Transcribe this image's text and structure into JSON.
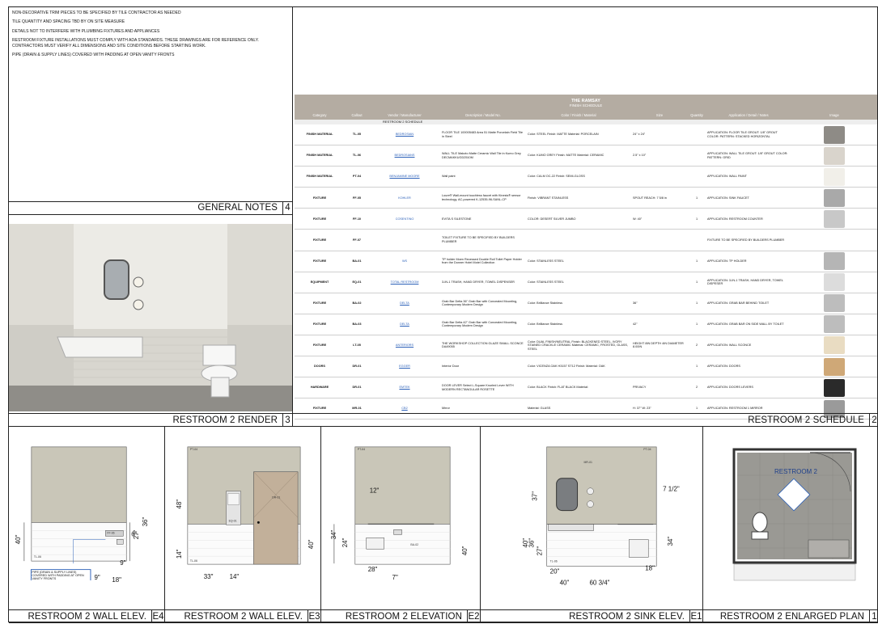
{
  "notes": {
    "lines": [
      "NON-DECORATIVE TRIM PIECES TO BE SPECIFIED BY TILE CONTRACTOR AS NEEDED",
      "TILE QUANTITY AND SPACING TBD BY ON SITE MEASURE",
      "DETAILS NOT TO INTERFERE WITH PLUMBING FIXTURES AND APPLIANCES",
      "RESTROOM FIXTURE INSTALLATIONS MUST COMPLY WITH ADA STANDARDS. THESE DRAWINGS ARE FOR REFERENCE ONLY. CONTRACTORS MUST VERIFY ALL DIMENSIONS AND SITE CONDITIONS BEFORE STARTING WORK.",
      "PIPE (DRAIN & SUPPLY LINES) COVERED WITH PADDING AT OPEN VANITY FRONTS"
    ],
    "title": "GENERAL NOTES",
    "number": "4"
  },
  "render": {
    "title": "RESTROOM 2 RENDER",
    "number": "3"
  },
  "schedule": {
    "title": "RESTROOM 2 SCHEDULE",
    "number": "2",
    "header_title": "THE RAMSAY",
    "header_subtitle": "FINISH SCHEDULE",
    "section": "RESTROOM 2 SCHEDULE",
    "columns": [
      "Category",
      "Callout",
      "Vendor / Manufacturer",
      "Description / Model No.",
      "Color / Finish / Material",
      "Size",
      "Quantity",
      "Application / Detail / Notes",
      "Image"
    ],
    "rows": [
      {
        "cat": "FINISH MATERIAL",
        "call": "TL-05",
        "vend": "BEDROSIAN",
        "desc": "FLOOR TILE 100005483 Area 51 Matte Porcelain Field Tile in Steel",
        "color": "Color: STEEL Finish: MATTE Material: PORCELAIN",
        "size": "24\" x 24\"",
        "qty": "",
        "app": "APPLICATION: FLOOR TILE GROUT: 1/8\" GROUT COLOR: PATTERN: STACKED HORIZONTAL",
        "img": "#8e8b86"
      },
      {
        "cat": "FINISH MATERIAL",
        "call": "TL-06",
        "vend": "BEDROSIANS",
        "desc": "WALL TILE Makoto Matte Ceramic Wall Tile in Kumo Grey DECMAKKUGD2510M",
        "color": "Color: KUMO GREY Finish: MATTE Material: CERAMIC",
        "size": "2.5\" x 10\"",
        "qty": "",
        "app": "APPLICATION: WALL TILE GROUT: 1/8\" GROUT COLOR: PATTERN: GRID",
        "img": "#d9d4cc"
      },
      {
        "cat": "FINISH MATERIAL",
        "call": "PT-04",
        "vend": "BENJAMINE MOORE",
        "desc": "Wall paint",
        "color": "Color: CALM OC-22 Finish: SEMI-GLOSS",
        "size": "",
        "qty": "",
        "app": "APPLICATION: WALL PAINT",
        "img": "#f1efe9"
      },
      {
        "cat": "FIXTURE",
        "call": "FF-05",
        "vend": "KOHLER",
        "desc": "Loure® Wall-mount touchless faucet with Kinesis® sensor technology, AC-powered K-12535-96-SANL-CP",
        "color": "Finish: VIBRANT STAINLESS",
        "size": "SPOUT REACH: 7 5/8 in",
        "qty": "1",
        "app": "APPLICATION: SINK FAUCET",
        "img": "#a9a9a9"
      },
      {
        "cat": "FIXTURE",
        "call": "FF-10",
        "vend": "COSENTINO",
        "desc": "EVITA S SILESTONE",
        "color": "COLOR: DESERT SILVER JUMBO",
        "size": "W: 40\"",
        "qty": "1",
        "app": "APPLICATION: RESTROOM COUNTER",
        "img": "#c8c8c8"
      },
      {
        "cat": "FIXTURE",
        "call": "FF-07",
        "vend": "",
        "desc": "TOILET FIXTURE TO BE SPECIFIED BY BUILDERS PLUMBER",
        "color": "",
        "size": "",
        "qty": "",
        "app": "FIXTURE TO BE SPECIFIED BY BUILDERS PLUMBER",
        "img": ""
      },
      {
        "cat": "FIXTURE",
        "call": "BA-01",
        "vend": "WS",
        "desc": "TP holder Moen Recessed Double Roll Toilet Paper Holder from the Donner Hotel Motel Collection",
        "color": "Color: STAINLESS STEEL",
        "size": "",
        "qty": "1",
        "app": "APPLICATION: TP HOLDER",
        "img": "#b5b5b5"
      },
      {
        "cat": "EQUIPMENT",
        "call": "EQ-01",
        "vend": "TOTAL RESTROOM",
        "desc": "3-IN-1 TRASH, HAND DRYER, TOWEL DISPENSER",
        "color": "Color: STAINLESS STEEL",
        "size": "",
        "qty": "1",
        "app": "APPLICATION: 3-IN-1 TRASH, HAND DRYER, TOWEL DISPESER",
        "img": "#dcdcdc"
      },
      {
        "cat": "FIXTURE",
        "call": "BA-02",
        "vend": "DELTA",
        "desc": "Grab Bar Delta 36\" Grab Bar with Concealed Mounting, Contemporary Modern Design",
        "color": "Color: Brilliance Stainless",
        "size": "36\"",
        "qty": "1",
        "app": "APPLICATION: GRAB BAR BEHIND TOILET",
        "img": "#bdbdbd"
      },
      {
        "cat": "FIXTURE",
        "call": "BA-03",
        "vend": "DELTA",
        "desc": "Grab Bar Delta 42\" Grab Bar with Concealed Mounting, Contemporary Modern Design",
        "color": "Color: Brilliance Stainless",
        "size": "42\"",
        "qty": "1",
        "app": "APPLICATION: GRAB BAR ON SIDE WALL BY TOILET",
        "img": "#bdbdbd"
      },
      {
        "cat": "FIXTURE",
        "call": "LT-05",
        "vend": "ANTERIORS",
        "desc": "THE WORKSHOP COLLECTION GLAZE SMALL SCONCE DA49055",
        "color": "Color: DUAL FINISH/NEUTRAL Finish: BLACKENED STEEL, IVORY STAINED CRACKLE CERAMIC Material: CERAMIC, FROSTED, GLASS, STEEL",
        "size": "HEIGHT 8IN DEPTH 4IN DIAMETER 8.00IN",
        "qty": "2",
        "app": "APPLICATION: WALL SCONCE",
        "img": "#e9dcc2"
      },
      {
        "cat": "DOORS",
        "call": "DR-01",
        "vend": "EGGER",
        "desc": "Interior Door",
        "color": "Color: VICENZA OAK H3157 ST12 Finish: Material: OAK",
        "size": "",
        "qty": "1",
        "app": "APPLICATION: DOORS",
        "img": "#cfa877"
      },
      {
        "cat": "HARDWARE",
        "call": "DR-01",
        "vend": "EMTEK",
        "desc": "DOOR LEVER Select L-Square Knurled Lever WITH MODERN RECTANGULAR ROSETTE",
        "color": "Color: BLACK Finish: FLAT BLACK Material:",
        "size": "PRIVACY",
        "qty": "2",
        "app": "APPLICATION: DOORS LEVERS",
        "img": "#2a2a2a"
      },
      {
        "cat": "FIXTURE",
        "call": "MR-01",
        "vend": "CB2",
        "desc": "Mirror",
        "color": "Material: GLASS",
        "size": "H: 37\" W: 23\"",
        "qty": "1",
        "app": "APPLICATION: RESTROOM 1 MIRROR",
        "img": "#9a9a9a"
      }
    ]
  },
  "views": [
    {
      "title": "RESTROOM 2 WALL ELEV.",
      "number": "E4"
    },
    {
      "title": "RESTROOM 2 WALL ELEV.",
      "number": "E3"
    },
    {
      "title": "RESTROOM 2 ELEVATION",
      "number": "E2"
    },
    {
      "title": "RESTROOM 2 SINK ELEV.",
      "number": "E1"
    },
    {
      "title": "RESTROOM 2 ENLARGED PLAN",
      "number": "1"
    }
  ],
  "e4": {
    "pipe_note": "PIPE (DRAIN & SUPPLY LINES) COVERED WITH PADDING AT OPEN VANITY FRONTS",
    "d40": "40\"",
    "d36": "36\"",
    "d27": "27\"",
    "d6": "6\"",
    "d9a": "9\"",
    "d9b": "9\"",
    "d18": "18\"",
    "tl": "TL-06",
    "ff": "FF-06"
  },
  "e3": {
    "d48": "48\"",
    "d14": "14\"",
    "d40": "40\"",
    "d33": "33\"",
    "d14b": "14\"",
    "pt": "PT-04",
    "eq": "EQ-01",
    "dr": "DR-01",
    "tl": "TL-06"
  },
  "e2": {
    "d12": "12\"",
    "d34": "34\"",
    "d24": "24\"",
    "d28": "28\"",
    "d7": "7\"",
    "d40": "40\"",
    "pt": "PT-04",
    "ba": "BA-02"
  },
  "e1": {
    "d37": "37\"",
    "d40": "40\"",
    "d36": "36\"",
    "d27": "27\"",
    "d712": "7 1/2\"",
    "d34": "34\"",
    "d18": "18\"",
    "d20": "20\"",
    "d40b": "40\"",
    "d6034": "60 3/4\"",
    "mr": "MR-01",
    "pt": "PT-04",
    "tl": "TL-06"
  },
  "p1": {
    "room": "RESTROOM 2"
  }
}
